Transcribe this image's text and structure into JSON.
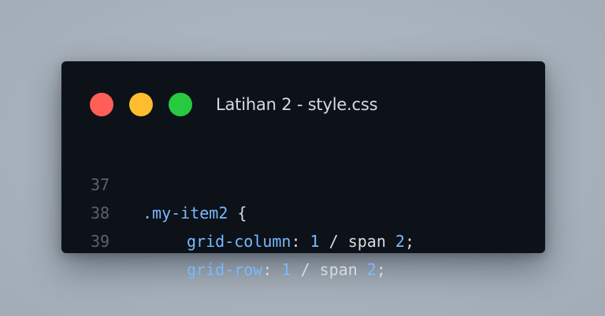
{
  "window": {
    "title": "Latihan 2 - style.css",
    "controls": {
      "close_color": "#ff5f57",
      "minimize_color": "#ffbd2e",
      "maximize_color": "#28c940"
    }
  },
  "code": {
    "lines": [
      {
        "number": "37",
        "selector": ".my-item2",
        "open_brace": " {"
      },
      {
        "number": "38",
        "property": "grid-column",
        "colon": ": ",
        "value_start": "1",
        "value_mid": " / span ",
        "value_end": "2",
        "semicolon": ";"
      },
      {
        "number": "39",
        "property": "grid-row",
        "colon": ": ",
        "value_start": "1",
        "value_mid": " / span ",
        "value_end": "2",
        "semicolon": ";"
      }
    ]
  },
  "colors": {
    "background": "#a9b3bd",
    "window_bg": "#0d1118",
    "text": "#d6dbe2",
    "keyword": "#79b8ff",
    "line_number": "#5b636d"
  }
}
